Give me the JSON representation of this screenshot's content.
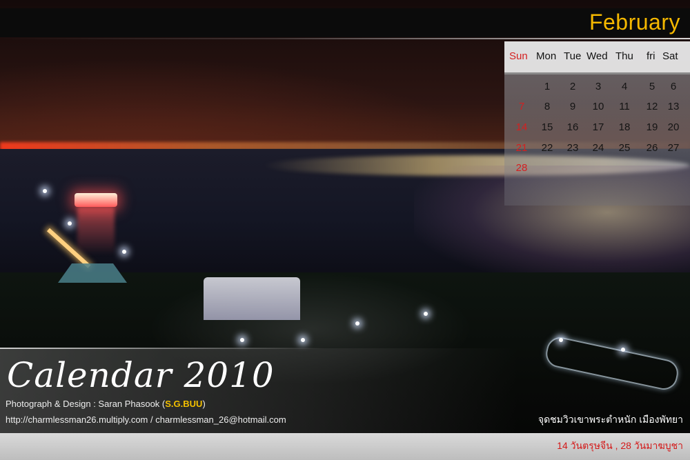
{
  "header": {
    "month": "February"
  },
  "calendar": {
    "day_names": [
      "Sun",
      "Mon",
      "Tue",
      "Wed",
      "Thu",
      "fri",
      "Sat"
    ],
    "weeks": [
      [
        "",
        "1",
        "2",
        "3",
        "4",
        "5",
        "6"
      ],
      [
        "7",
        "8",
        "9",
        "10",
        "11",
        "12",
        "13"
      ],
      [
        "14",
        "15",
        "16",
        "17",
        "18",
        "19",
        "20"
      ],
      [
        "21",
        "22",
        "23",
        "24",
        "25",
        "26",
        "27"
      ],
      [
        "28",
        "",
        "",
        "",
        "",
        "",
        ""
      ]
    ],
    "accent_color": "#d42020"
  },
  "title": {
    "text": "Calendar 2010"
  },
  "credits": {
    "label": "Photograph & Design : Saran Phasook (",
    "brand": "S.G.BUU",
    "close": ")",
    "links": "http://charmlessman26.multiply.com / charmlessman_26@hotmail.com"
  },
  "place": {
    "caption": "จุดชมวิวเขาพระตำหนัก  เมืองพัทยา"
  },
  "footer": {
    "holidays": "14  วันตรุษจีน , 28  วันมาฆบูชา"
  },
  "colors": {
    "month": "#f5b800",
    "brand": "#f3c000",
    "holiday": "#d41a1a"
  }
}
